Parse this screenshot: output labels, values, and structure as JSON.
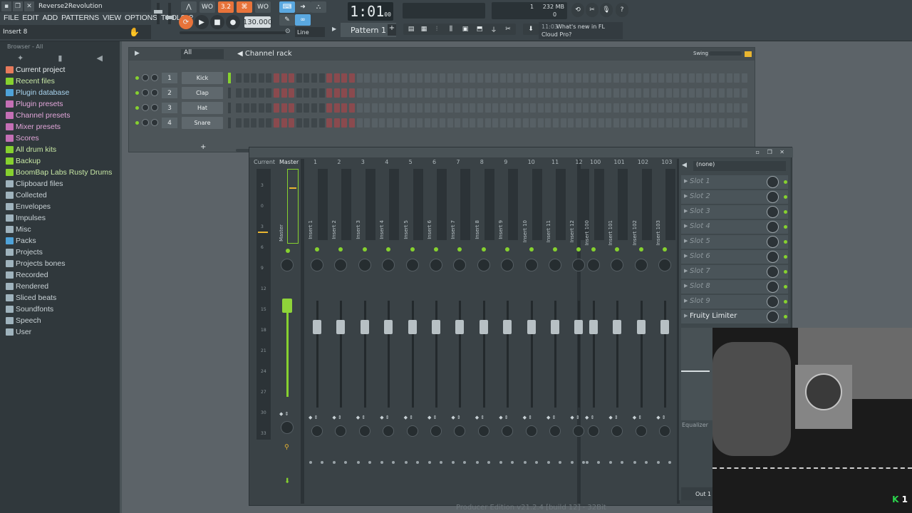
{
  "window": {
    "title": "Reverse2Revolution"
  },
  "menu": [
    "FILE",
    "EDIT",
    "ADD",
    "PATTERNS",
    "VIEW",
    "OPTIONS",
    "TOOLS",
    "?"
  ],
  "hint_bar": "Insert 8",
  "transport": {
    "tempo": "130.000",
    "song_position": "1:01",
    "song_position_ticks": "00",
    "snap": "Line",
    "pattern": "Pattern 1",
    "memory": "232 MB",
    "cpu": "1",
    "polyphony": "0"
  },
  "toolbar_labels": {
    "b1": "3.2",
    "b2": "WO"
  },
  "news": {
    "time": "11:03",
    "line1": "What's new in FL",
    "line2": "Cloud Pro?"
  },
  "browser": {
    "header": "Browser - All",
    "items": [
      {
        "label": "Current project",
        "icon_color": "#e77a5c",
        "color": "#e6ecee"
      },
      {
        "label": "Recent files",
        "icon_color": "#86d12f",
        "color": "#c6e6a4"
      },
      {
        "label": "Plugin database",
        "icon_color": "#4fa3d9",
        "color": "#a8d3ee"
      },
      {
        "label": "Plugin presets",
        "icon_color": "#c46fb5",
        "color": "#e2a6da"
      },
      {
        "label": "Channel presets",
        "icon_color": "#c46fb5",
        "color": "#e2a6da"
      },
      {
        "label": "Mixer presets",
        "icon_color": "#c46fb5",
        "color": "#e2a6da"
      },
      {
        "label": "Scores",
        "icon_color": "#c46fb5",
        "color": "#e2a6da"
      },
      {
        "label": "All drum kits",
        "icon_color": "#86d12f",
        "color": "#c6e6a4"
      },
      {
        "label": "Backup",
        "icon_color": "#86d12f",
        "color": "#c6e6a4"
      },
      {
        "label": "BoomBap Labs Rusty Drums",
        "icon_color": "#86d12f",
        "color": "#c6e6a4"
      },
      {
        "label": "Clipboard files",
        "icon_color": "#9fb3bd",
        "color": "#c9d2d6"
      },
      {
        "label": "Collected",
        "icon_color": "#9fb3bd",
        "color": "#c9d2d6"
      },
      {
        "label": "Envelopes",
        "icon_color": "#9fb3bd",
        "color": "#c9d2d6"
      },
      {
        "label": "Impulses",
        "icon_color": "#9fb3bd",
        "color": "#c9d2d6"
      },
      {
        "label": "Misc",
        "icon_color": "#9fb3bd",
        "color": "#c9d2d6"
      },
      {
        "label": "Packs",
        "icon_color": "#4fa3d9",
        "color": "#c9d2d6"
      },
      {
        "label": "Projects",
        "icon_color": "#9fb3bd",
        "color": "#c9d2d6"
      },
      {
        "label": "Projects bones",
        "icon_color": "#9fb3bd",
        "color": "#c9d2d6"
      },
      {
        "label": "Recorded",
        "icon_color": "#9fb3bd",
        "color": "#c9d2d6"
      },
      {
        "label": "Rendered",
        "icon_color": "#9fb3bd",
        "color": "#c9d2d6"
      },
      {
        "label": "Sliced beats",
        "icon_color": "#9fb3bd",
        "color": "#c9d2d6"
      },
      {
        "label": "Soundfonts",
        "icon_color": "#9fb3bd",
        "color": "#c9d2d6"
      },
      {
        "label": "Speech",
        "icon_color": "#9fb3bd",
        "color": "#c9d2d6"
      },
      {
        "label": "User",
        "icon_color": "#9fb3bd",
        "color": "#c9d2d6"
      }
    ]
  },
  "channel_rack": {
    "title": "Channel rack",
    "filter": "All",
    "swing_label": "Swing",
    "channels": [
      {
        "num": "1",
        "name": "Kick",
        "selected": true
      },
      {
        "num": "2",
        "name": "Clap",
        "selected": false
      },
      {
        "num": "3",
        "name": "Hat",
        "selected": false
      },
      {
        "num": "4",
        "name": "Snare",
        "selected": false
      }
    ],
    "add_label": "+"
  },
  "mixer": {
    "top_labels": {
      "current": "Current",
      "master": "Master"
    },
    "tracks": [
      {
        "num": "1",
        "name": "Insert 1"
      },
      {
        "num": "2",
        "name": "Insert 2"
      },
      {
        "num": "3",
        "name": "Insert 3"
      },
      {
        "num": "4",
        "name": "Insert 4"
      },
      {
        "num": "5",
        "name": "Insert 5"
      },
      {
        "num": "6",
        "name": "Insert 6"
      },
      {
        "num": "7",
        "name": "Insert 7"
      },
      {
        "num": "8",
        "name": "Insert 8"
      },
      {
        "num": "9",
        "name": "Insert 9"
      },
      {
        "num": "10",
        "name": "Insert 10"
      },
      {
        "num": "11",
        "name": "Insert 11"
      },
      {
        "num": "12",
        "name": "Insert 12"
      }
    ],
    "tracks_right": [
      {
        "num": "100",
        "name": "Insert 100"
      },
      {
        "num": "101",
        "name": "Insert 101"
      },
      {
        "num": "102",
        "name": "Insert 102"
      },
      {
        "num": "103",
        "name": "Insert 103"
      }
    ],
    "master_name": "Master",
    "db_scale": [
      "3",
      "0",
      "3",
      "6",
      "9",
      "12",
      "15",
      "18",
      "21",
      "24",
      "27",
      "30",
      "33"
    ]
  },
  "fx_panel": {
    "preset": "(none)",
    "slots": [
      "Slot 1",
      "Slot 2",
      "Slot 3",
      "Slot 4",
      "Slot 5",
      "Slot 6",
      "Slot 7",
      "Slot 8",
      "Slot 9",
      "Fruity Limiter"
    ],
    "equalizer_label": "Equalizer",
    "output": "Out 1"
  },
  "footer": "Producer Edition v21.2.4 [build 12] - 32Bit",
  "webcam": {
    "badge_k": "K",
    "badge_n": "1"
  }
}
